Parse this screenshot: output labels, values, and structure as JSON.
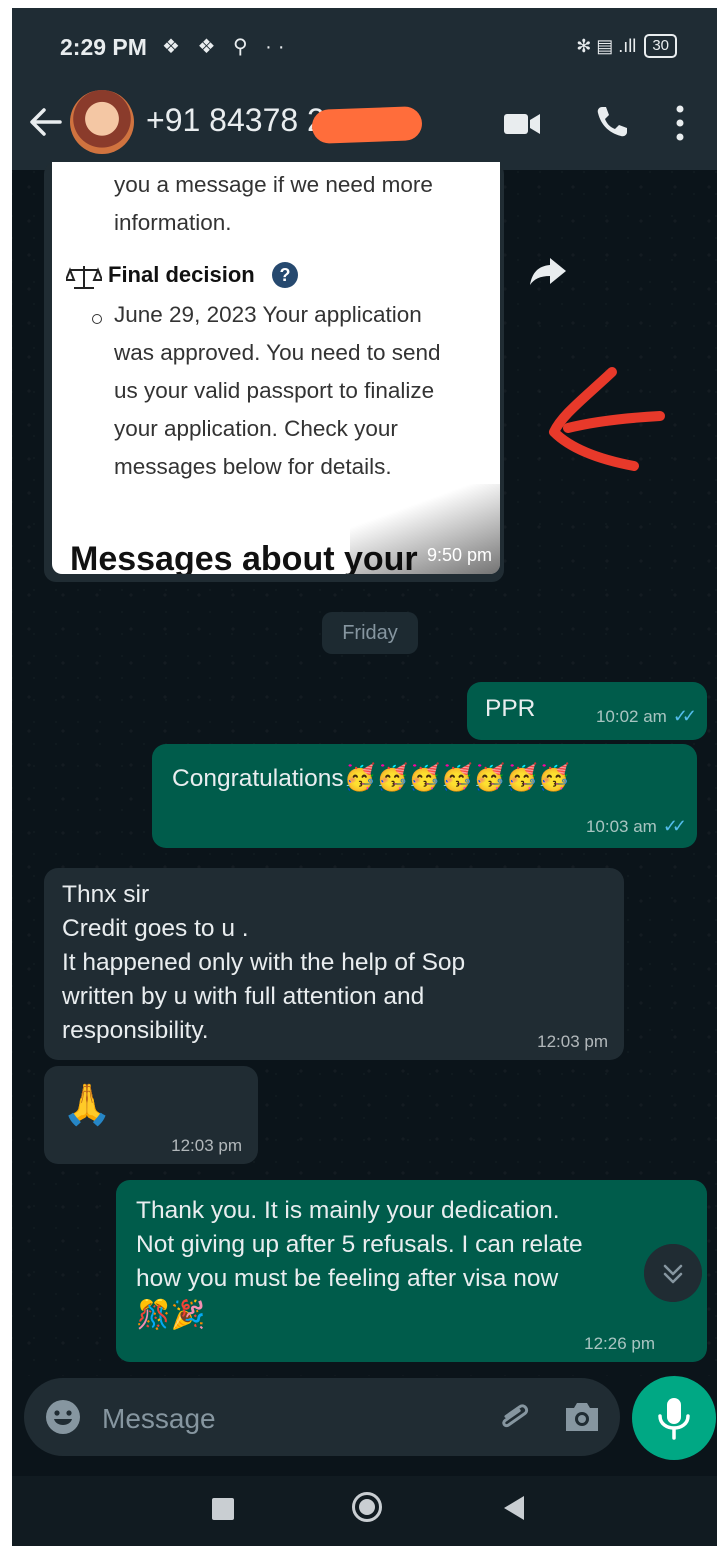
{
  "status_bar": {
    "time": "2:29 PM",
    "left_icons": "❖ ❖ ⚲ ··",
    "right_icons": "✻ ▤ .ıll",
    "battery": "30"
  },
  "header": {
    "contact": "+91 84378 2",
    "icons": [
      "back-arrow-icon",
      "video-call-icon",
      "voice-call-icon",
      "more-options-icon"
    ]
  },
  "image_message": {
    "doc_lines": [
      "you a message if we need more",
      "information."
    ],
    "heading": "Final decision",
    "decision_lines": [
      "June 29, 2023 Your application",
      "was approved. You need to send",
      "us your valid passport to finalize",
      "your application. Check your",
      "messages below for details."
    ],
    "footer": "Messages about your",
    "time": "9:50 pm"
  },
  "date_chip": "Friday",
  "messages": [
    {
      "text": "PPR",
      "time": "10:02 am"
    },
    {
      "text": "Congratulations",
      "emoji": "🥳🥳🥳🥳🥳🥳🥳",
      "time": "10:03 am"
    },
    {
      "text": "Thnx sir\nCredit goes to u .\nIt happened only with the help of Sop\nwritten by u with full attention and\nresponsibility.",
      "time": "12:03 pm"
    },
    {
      "text": "🙏",
      "time": "12:03 pm"
    },
    {
      "text": "Thank you. It is mainly your dedication.\nNot giving up  after 5 refusals. I can relate\nhow you must be feeling after visa  now",
      "emoji": "🎊🎉",
      "time": "12:26 pm"
    }
  ],
  "composer": {
    "placeholder": "Message"
  },
  "colors": {
    "outgoing": "#005c4b",
    "incoming": "#202c33",
    "accent": "#00a884",
    "read_ticks": "#53bdeb"
  }
}
